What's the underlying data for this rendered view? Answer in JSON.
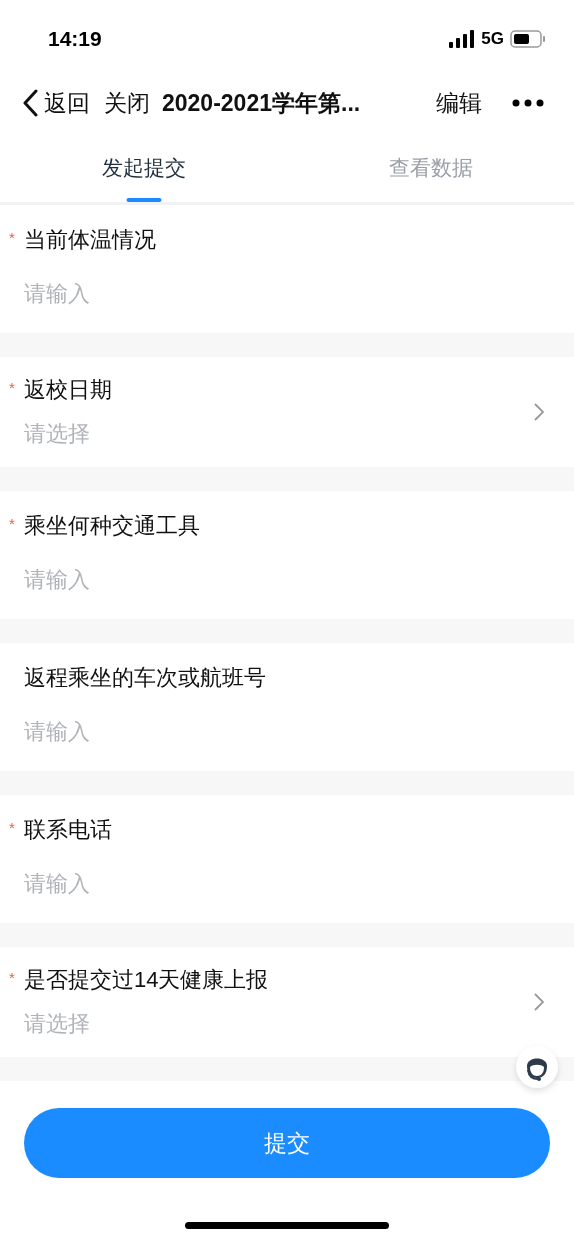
{
  "status_bar": {
    "time": "14:19",
    "network": "5G"
  },
  "nav": {
    "back": "返回",
    "close": "关闭",
    "title": "2020-2021学年第...",
    "edit": "编辑"
  },
  "tabs": [
    {
      "label": "发起提交",
      "selected": true
    },
    {
      "label": "查看数据",
      "selected": false
    }
  ],
  "fields": [
    {
      "kind": "input",
      "required_mark": "*",
      "label": "当前体温情况",
      "placeholder": "请输入"
    },
    {
      "kind": "select",
      "required_mark": "*",
      "label": "返校日期",
      "placeholder": "请选择"
    },
    {
      "kind": "input",
      "required_mark": "*",
      "label": "乘坐何种交通工具",
      "placeholder": "请输入"
    },
    {
      "kind": "input",
      "label": "返程乘坐的车次或航班号",
      "placeholder": "请输入"
    },
    {
      "kind": "input",
      "required_mark": "*",
      "label": "联系电话",
      "placeholder": "请输入"
    },
    {
      "kind": "select",
      "required_mark": "*",
      "label": "是否提交过14天健康上报",
      "placeholder": "请选择"
    }
  ],
  "submit": "提交"
}
